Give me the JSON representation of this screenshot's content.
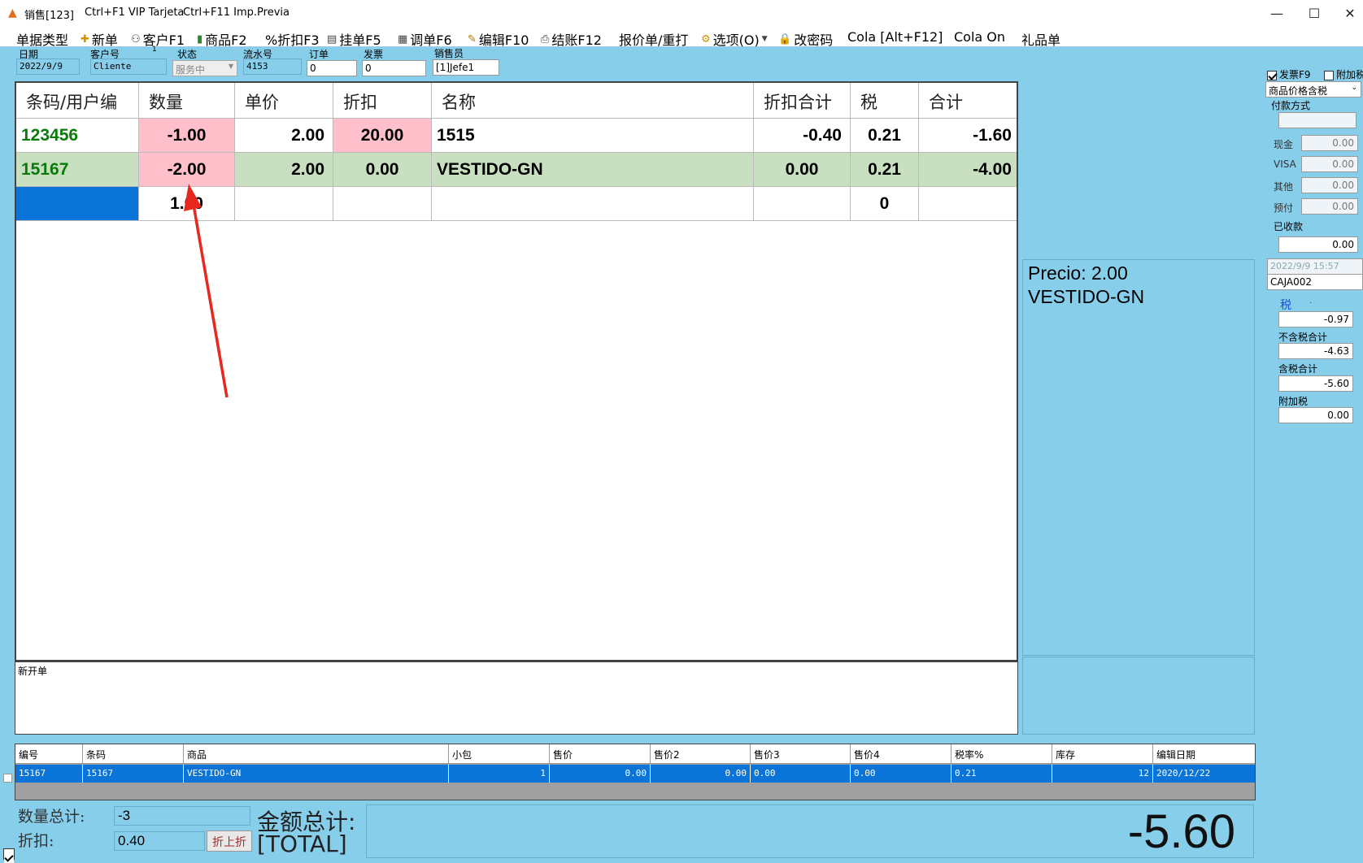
{
  "window": {
    "title": "销售[123]",
    "shortcut1": "Ctrl+F1 VIP Tarjeta",
    "shortcut2": "Ctrl+F11 Imp.Previa",
    "minimize": "—",
    "maximize": "☐",
    "close": "✕"
  },
  "menu": {
    "doc_type": "单据类型",
    "new": "新单",
    "customer": "客户F1",
    "product": "商品F2",
    "discount": "%折扣F3",
    "hold": "挂单F5",
    "recall": "调单F6",
    "edit": "编辑F10",
    "checkout": "结账F12",
    "quote": "报价单/重打",
    "options": "选项(O)",
    "password": "改密码",
    "cola_alt": "Cola [Alt+F12]",
    "cola_on": "Cola On",
    "gift": "礼品单"
  },
  "fields": {
    "date_label": "日期",
    "date_value": "2022/9/9",
    "customer_label": "客户号",
    "customer_num": "1",
    "customer_value": "Cliente",
    "status_label": "状态",
    "status_value": "服务中",
    "serial_label": "流水号",
    "serial_value": "4153",
    "order_label": "订单",
    "order_value": "0",
    "invoice_label": "发票",
    "invoice_value": "0",
    "seller_label": "销售员",
    "seller_value": "[1]Jefe1"
  },
  "grid": {
    "headers": [
      "条码/用户编",
      "数量",
      "单价",
      "折扣",
      "名称",
      "折扣合计",
      "税",
      "合计"
    ],
    "rows": [
      {
        "code": "123456",
        "qty": "-1.00",
        "price": "2.00",
        "disc": "20.00",
        "name": "1515",
        "disc_total": "-0.40",
        "tax": "0.21",
        "total": "-1.60"
      },
      {
        "code": "15167",
        "qty": "-2.00",
        "price": "2.00",
        "disc": "0.00",
        "name": "VESTIDO-GN",
        "disc_total": "0.00",
        "tax": "0.21",
        "total": "-4.00"
      },
      {
        "code": "",
        "qty": "1.00",
        "price": "",
        "disc": "",
        "name": "",
        "disc_total": "",
        "tax": "0",
        "total": ""
      }
    ]
  },
  "notes_label": "新开单",
  "info": {
    "price_line": "Precio: 2.00",
    "name_line": "VESTIDO-GN"
  },
  "right": {
    "invoice_chk": "发票F9",
    "extra_tax_chk": "附加税",
    "price_mode": "商品价格含税",
    "pay_label": "付款方式",
    "cash_label": "现金",
    "cash": "0.00",
    "visa_label": "VISA",
    "visa": "0.00",
    "other_label": "其他",
    "other": "0.00",
    "prepay_label": "预付",
    "prepay": "0.00",
    "received_label": "已收款",
    "received": "0.00",
    "datetime": "2022/9/9 15:57",
    "register": "CAJA002",
    "tax_label": "税",
    "tax_dot": ".",
    "tax": "-0.97",
    "pretax_label": "不含税合计",
    "pretax": "-4.63",
    "withtax_label": "含税合计",
    "withtax": "-5.60",
    "addtax_label": "附加税",
    "addtax": "0.00"
  },
  "lookup": {
    "headers": [
      "编号",
      "条码",
      "商品",
      "小包",
      "售价",
      "售价2",
      "售价3",
      "售价4",
      "税率%",
      "库存",
      "编辑日期"
    ],
    "row": [
      "15167",
      "15167",
      "VESTIDO-GN",
      "1",
      "0.00",
      "0.00",
      "0.00",
      "0.00",
      "0.21",
      "12",
      "2020/12/22"
    ]
  },
  "bottom": {
    "qty_label": "数量总计:",
    "qty_value": "-3",
    "disc_label": "折扣:",
    "disc_value": "0.40",
    "disc_button": "折上折",
    "amount_label": "金额总计:",
    "total_label": "[TOTAL]",
    "total_value": "-5.60"
  },
  "colors": {
    "background": "#87CEEB",
    "pink": "#FFC0CB",
    "row_green": "#C8E0C0",
    "code_green": "#0A7A0A",
    "selection_blue": "#0A74D8",
    "arrow_red": "#E8281E"
  }
}
